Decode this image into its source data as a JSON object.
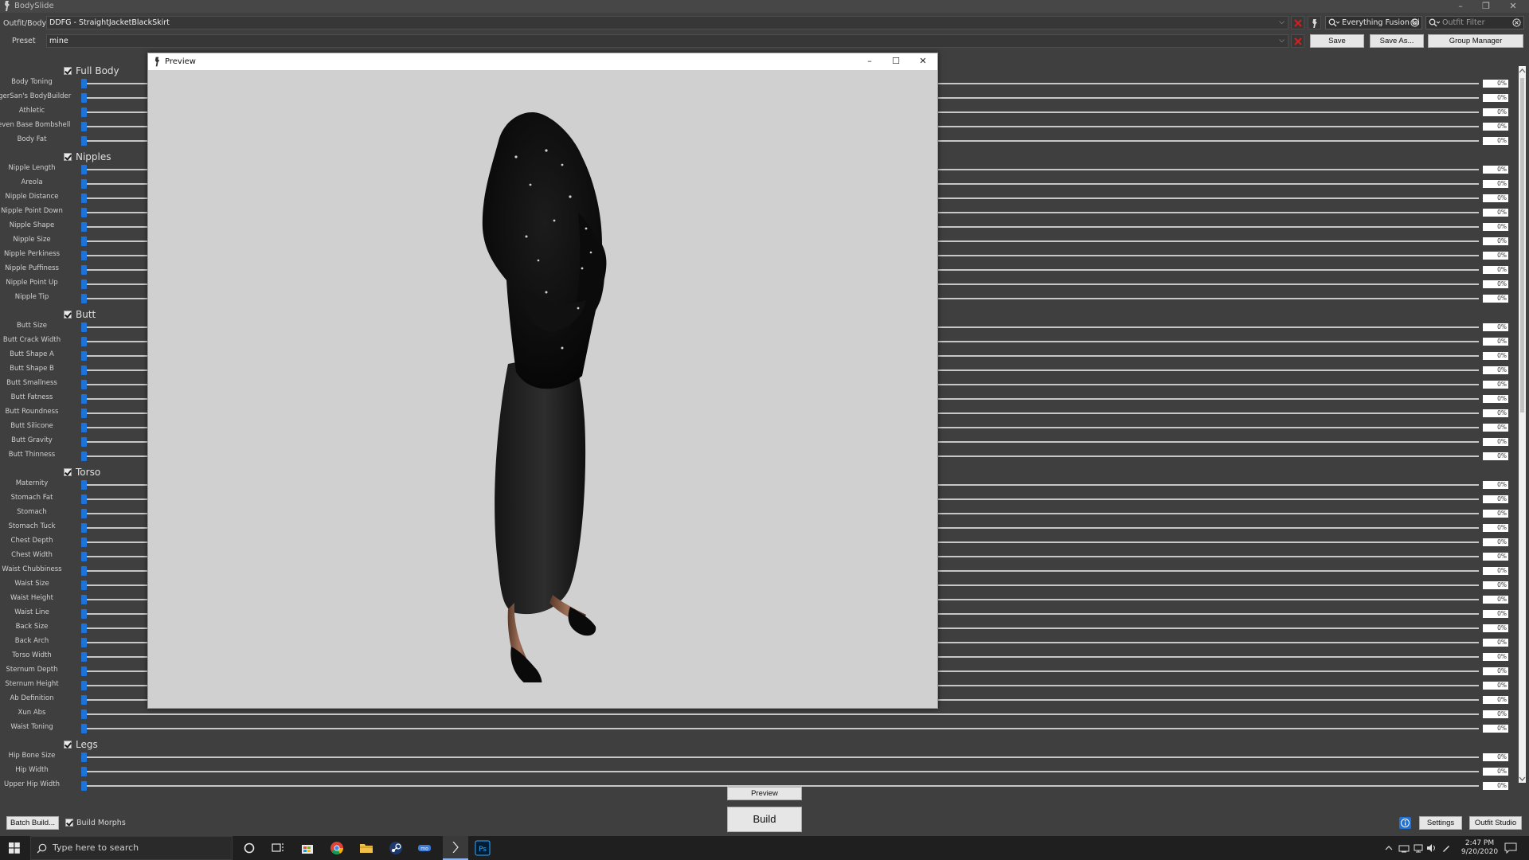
{
  "window": {
    "title": "BodySlide"
  },
  "top_bar": {
    "outfit_label": "Outfit/Body",
    "outfit_value": "DDFG - StraightJacketBlackSkirt",
    "preset_label": "Preset",
    "preset_value": "mine",
    "group_filter": "Everything Fusion Gi",
    "outfit_filter_placeholder": "Outfit Filter",
    "save": "Save",
    "save_as": "Save As...",
    "group_manager": "Group Manager"
  },
  "categories": [
    {
      "name": "Full Body",
      "sliders": [
        "Body Toning",
        "TigerSan's BodyBuilder",
        "Athletic",
        "Seven Base Bombshell",
        "Body Fat"
      ]
    },
    {
      "name": "Nipples",
      "sliders": [
        "Nipple Length",
        "Areola",
        "Nipple Distance",
        "Nipple Point Down",
        "Nipple Shape",
        "Nipple Size",
        "Nipple Perkiness",
        "Nipple Puffiness",
        "Nipple Point Up",
        "Nipple Tip"
      ]
    },
    {
      "name": "Butt",
      "sliders": [
        "Butt Size",
        "Butt Crack Width",
        "Butt Shape A",
        "Butt Shape B",
        "Butt Smallness",
        "Butt Fatness",
        "Butt Roundness",
        "Butt Silicone",
        "Butt Gravity",
        "Butt Thinness"
      ]
    },
    {
      "name": "Torso",
      "sliders": [
        "Maternity",
        "Stomach Fat",
        "Stomach",
        "Stomach Tuck",
        "Chest Depth",
        "Chest Width",
        "Waist Chubbiness",
        "Waist Size",
        "Waist Height",
        "Waist Line",
        "Back Size",
        "Back Arch",
        "Torso Width",
        "Sternum Depth",
        "Sternum Height",
        "Ab Definition",
        "Xun Abs",
        "Waist Toning"
      ]
    },
    {
      "name": "Legs",
      "sliders": [
        "Hip Bone Size",
        "Hip Width",
        "Upper Hip Width"
      ]
    }
  ],
  "slider_value": "0%",
  "preview_window": {
    "title": "Preview"
  },
  "bottom": {
    "preview_button": "Preview",
    "build_button": "Build",
    "batch_build": "Batch Build...",
    "build_morphs": "Build Morphs",
    "settings": "Settings",
    "outfit_studio": "Outfit Studio"
  },
  "taskbar": {
    "search_placeholder": "Type here to search",
    "time": "2:47 PM",
    "date": "9/20/2020"
  },
  "colors": {
    "accent": "#1e73d8",
    "background": "#3f3f3f",
    "close_red": "#d11f1f"
  }
}
